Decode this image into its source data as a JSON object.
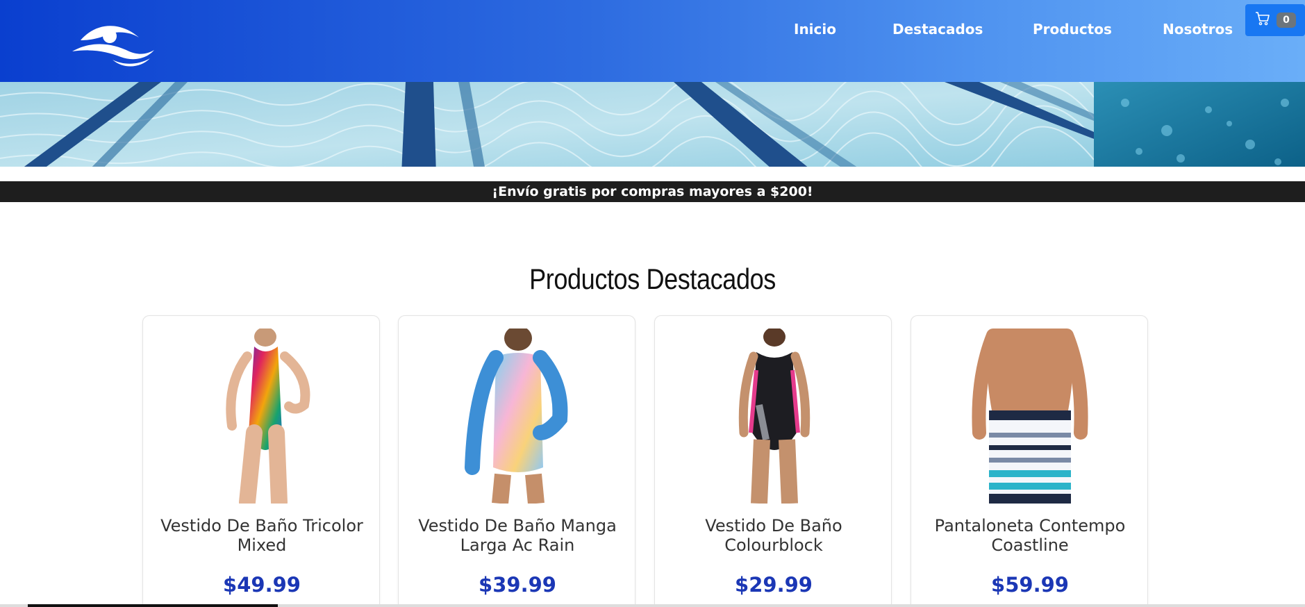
{
  "header": {
    "logo_icon": "swimmer-logo-icon",
    "nav": [
      {
        "label": "Inicio"
      },
      {
        "label": "Destacados"
      },
      {
        "label": "Productos"
      },
      {
        "label": "Nosotros"
      }
    ],
    "cart": {
      "icon": "shopping-cart-icon",
      "count": "0"
    }
  },
  "banner": {
    "image": "swimming-pool-lanes"
  },
  "shipping_notice": "¡Envío gratis por compras mayores a $200!",
  "featured": {
    "title": "Productos Destacados",
    "products": [
      {
        "name": "Vestido De Baño Tricolor Mixed",
        "price": "$49.99",
        "image": "women-swimsuit-tricolor"
      },
      {
        "name": "Vestido De Baño Manga Larga Ac Rain",
        "price": "$39.99",
        "image": "girls-long-sleeve-swimsuit"
      },
      {
        "name": "Vestido De Baño Colourblock",
        "price": "$29.99",
        "image": "women-swimsuit-black-pink"
      },
      {
        "name": "Pantaloneta Contempo Coastline",
        "price": "$59.99",
        "image": "men-swim-shorts-striped"
      }
    ]
  },
  "colors": {
    "header_start": "#0a3fcf",
    "header_end": "#6aaef8",
    "price": "#1b37b5",
    "strip": "#1e1e1e"
  }
}
